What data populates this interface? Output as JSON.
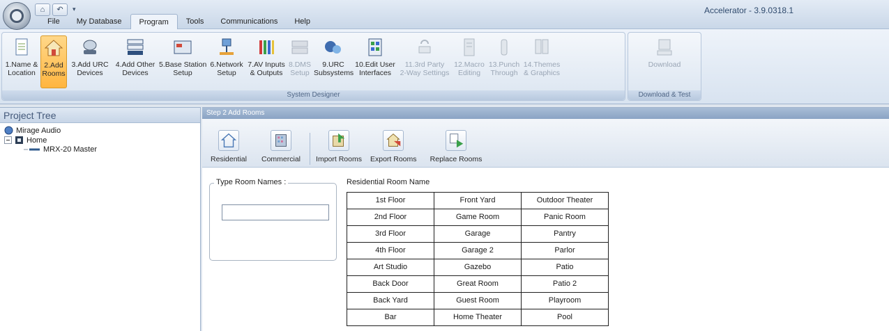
{
  "window": {
    "title": "Accelerator - 3.9.0318.1"
  },
  "menu": {
    "tabs": [
      {
        "label": "File"
      },
      {
        "label": "My Database"
      },
      {
        "label": "Program",
        "active": true
      },
      {
        "label": "Tools"
      },
      {
        "label": "Communications"
      },
      {
        "label": "Help"
      }
    ]
  },
  "ribbon": {
    "system_designer_label": "System Designer",
    "download_test_label": "Download & Test",
    "buttons": [
      {
        "label": "1.Name &\nLocation",
        "icon": "document-icon"
      },
      {
        "label": "2.Add\nRooms",
        "icon": "house-icon",
        "selected": true
      },
      {
        "label": "3.Add URC\nDevices",
        "icon": "router-icon"
      },
      {
        "label": "4.Add Other\nDevices",
        "icon": "rack-icon"
      },
      {
        "label": "5.Base Station\nSetup",
        "icon": "base-station-icon"
      },
      {
        "label": "6.Network\nSetup",
        "icon": "network-icon"
      },
      {
        "label": "7.AV Inputs\n& Outputs",
        "icon": "av-cables-icon"
      },
      {
        "label": "8.DMS\nSetup",
        "icon": "dms-icon",
        "disabled": true
      },
      {
        "label": "9.URC\nSubsystems",
        "icon": "subsystems-icon"
      },
      {
        "label": "10.Edit User\nInterfaces",
        "icon": "interfaces-icon"
      },
      {
        "label": "11.3rd Party\n2-Way Settings",
        "icon": "third-party-icon",
        "disabled": true
      },
      {
        "label": "12.Macro\nEditing",
        "icon": "macro-icon",
        "disabled": true
      },
      {
        "label": "13.Punch\nThrough",
        "icon": "punch-through-icon",
        "disabled": true
      },
      {
        "label": "14.Themes\n& Graphics",
        "icon": "themes-icon",
        "disabled": true
      }
    ],
    "download": {
      "label": "Download",
      "icon": "download-icon",
      "disabled": true
    }
  },
  "project_tree": {
    "title": "Project Tree",
    "root": "Mirage Audio",
    "home": "Home",
    "device": "MRX-20 Master"
  },
  "step": {
    "title": "Step 2 Add Rooms",
    "toolbar": [
      {
        "label": "Residential",
        "icon": "residential-house-icon"
      },
      {
        "label": "Commercial",
        "icon": "commercial-building-icon"
      },
      {
        "label": "Import Rooms",
        "icon": "import-rooms-icon"
      },
      {
        "label": "Export Rooms",
        "icon": "export-rooms-icon"
      },
      {
        "label": "Replace Rooms",
        "icon": "replace-rooms-icon"
      }
    ],
    "type_room_names_label": "Type Room Names :",
    "room_input_value": "",
    "grid_title": "Residential Room Name",
    "rooms": [
      [
        "1st Floor",
        "Front Yard",
        "Outdoor Theater"
      ],
      [
        "2nd Floor",
        "Game Room",
        "Panic Room"
      ],
      [
        "3rd Floor",
        "Garage",
        "Pantry"
      ],
      [
        "4th Floor",
        "Garage 2",
        "Parlor"
      ],
      [
        "Art Studio",
        "Gazebo",
        "Patio"
      ],
      [
        "Back Door",
        "Great Room",
        "Patio 2"
      ],
      [
        "Back Yard",
        "Guest Room",
        "Playroom"
      ],
      [
        "Bar",
        "Home Theater",
        "Pool"
      ]
    ]
  },
  "colors": {
    "selected_button": "#ffb53f",
    "ribbon_bg": "#dbe5f1",
    "group_label": "#4e6585"
  }
}
